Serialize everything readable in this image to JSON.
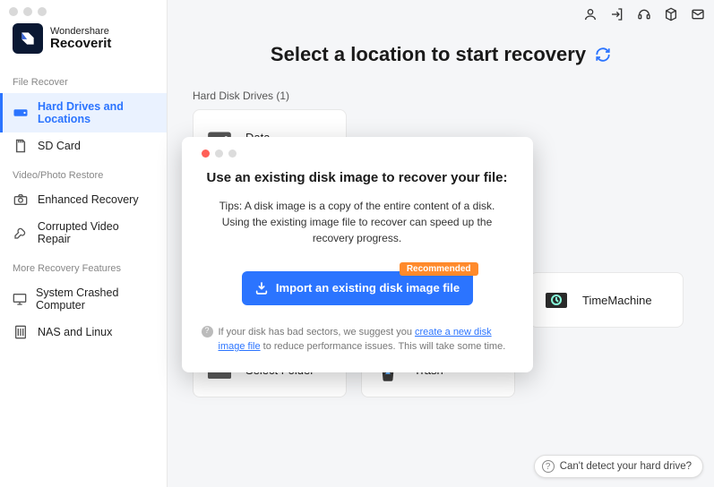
{
  "brand": {
    "line1": "Wondershare",
    "line2": "Recoverit"
  },
  "sidebar": {
    "sections": [
      {
        "label": "File Recover",
        "items": [
          {
            "label": "Hard Drives and Locations",
            "icon": "drive-icon",
            "active": true
          },
          {
            "label": "SD Card",
            "icon": "sdcard-icon",
            "active": false
          }
        ]
      },
      {
        "label": "Video/Photo Restore",
        "items": [
          {
            "label": "Enhanced Recovery",
            "icon": "camera-icon",
            "active": false
          },
          {
            "label": "Corrupted Video Repair",
            "icon": "wrench-icon",
            "active": false
          }
        ]
      },
      {
        "label": "More Recovery Features",
        "items": [
          {
            "label": "System Crashed Computer",
            "icon": "monitor-icon",
            "active": false
          },
          {
            "label": "NAS and Linux",
            "icon": "server-icon",
            "active": false
          }
        ]
      }
    ]
  },
  "page": {
    "title": "Select a location to start recovery",
    "hdd_section": "Hard Disk Drives (1)",
    "cards": {
      "data": "Data",
      "timemachine": "TimeMachine",
      "select_folder": "Select Folder",
      "trash": "Trash"
    }
  },
  "modal": {
    "title": "Use an existing disk image to recover your file:",
    "tip": "Tips: A disk image is a copy of the entire content of a disk. Using the existing image file to recover can speed up the recovery progress.",
    "badge": "Recommended",
    "button": "Import an existing disk image file",
    "note_prefix": "If your disk has bad sectors, we suggest you ",
    "note_link": "create a new disk image file",
    "note_suffix": " to reduce performance issues. This will take some time."
  },
  "help_bubble": "Can't detect your hard drive?"
}
